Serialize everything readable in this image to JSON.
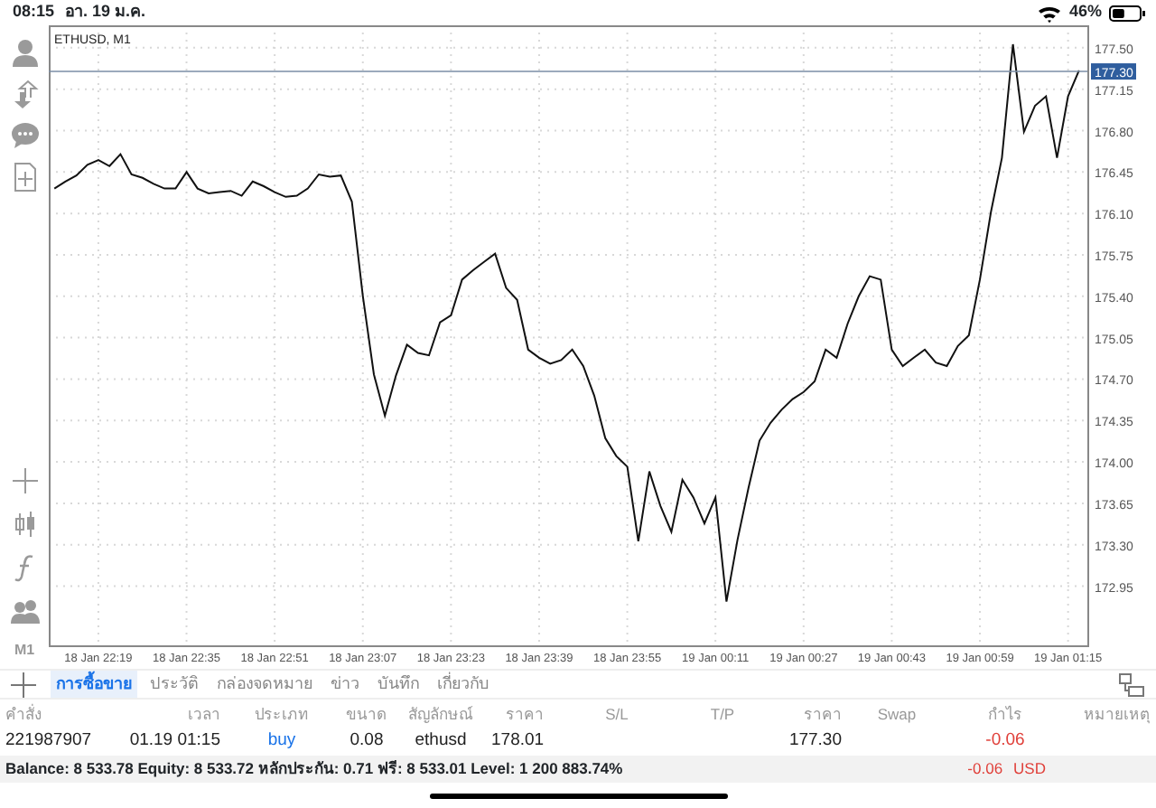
{
  "status_bar": {
    "time": "08:15",
    "date": "อา. 19 ม.ค.",
    "battery": "46%"
  },
  "left_toolbar": {
    "timeframe": "M1"
  },
  "chart": {
    "chart_data": {
      "type": "line",
      "title": "ETHUSD, M1",
      "grid": true,
      "ref_lines": [
        {
          "axis": "y",
          "value": 177.3,
          "label": "177.30"
        }
      ],
      "categories": [
        null,
        null,
        null,
        null,
        "18 Jan 22:19",
        null,
        null,
        null,
        null,
        null,
        null,
        null,
        "18 Jan 22:35",
        null,
        null,
        null,
        null,
        null,
        null,
        null,
        "18 Jan 22:51",
        null,
        null,
        null,
        null,
        null,
        null,
        null,
        "18 Jan 23:07",
        null,
        null,
        null,
        null,
        null,
        null,
        null,
        "18 Jan 23:23",
        null,
        null,
        null,
        null,
        null,
        null,
        null,
        "18 Jan 23:39",
        null,
        null,
        null,
        null,
        null,
        null,
        null,
        "18 Jan 23:55",
        null,
        null,
        null,
        null,
        null,
        null,
        null,
        "19 Jan 00:11",
        null,
        null,
        null,
        null,
        null,
        null,
        null,
        "19 Jan 00:27",
        null,
        null,
        null,
        null,
        null,
        null,
        null,
        "19 Jan 00:43",
        null,
        null,
        null,
        null,
        null,
        null,
        null,
        "19 Jan 00:59",
        null,
        null,
        null,
        null,
        null,
        null,
        null,
        "19 Jan 01:15",
        null
      ],
      "values": [
        176.31,
        176.37,
        176.42,
        176.51,
        176.55,
        176.5,
        176.6,
        176.43,
        176.4,
        176.35,
        176.31,
        176.31,
        176.45,
        176.31,
        176.27,
        176.28,
        176.29,
        176.25,
        176.37,
        176.33,
        176.28,
        176.24,
        176.25,
        176.31,
        176.43,
        176.41,
        176.42,
        176.2,
        175.4,
        174.74,
        174.39,
        174.73,
        174.99,
        174.92,
        174.9,
        175.18,
        175.24,
        175.54,
        175.62,
        175.69,
        175.76,
        175.47,
        175.37,
        174.95,
        174.88,
        174.83,
        174.86,
        174.95,
        174.81,
        174.56,
        174.2,
        174.05,
        173.96,
        173.33,
        173.92,
        173.63,
        173.41,
        173.85,
        173.7,
        173.48,
        173.7,
        172.82,
        173.34,
        173.78,
        174.18,
        174.33,
        174.44,
        174.53,
        174.59,
        174.68,
        174.95,
        174.88,
        175.17,
        175.4,
        175.57,
        175.54,
        174.95,
        174.81,
        174.88,
        174.95,
        174.84,
        174.81,
        174.98,
        175.07,
        175.54,
        176.11,
        176.57,
        177.53,
        176.79,
        177.01,
        177.09,
        176.57,
        177.09,
        177.31
      ],
      "ylim": [
        172.45,
        177.69
      ],
      "yticks": [
        {
          "value": 177.5,
          "label": "177.50"
        },
        {
          "value": 177.15,
          "label": "177.15"
        },
        {
          "value": 176.8,
          "label": "176.80"
        },
        {
          "value": 176.45,
          "label": "176.45"
        },
        {
          "value": 176.1,
          "label": "176.10"
        },
        {
          "value": 175.75,
          "label": "175.75"
        },
        {
          "value": 175.4,
          "label": "175.40"
        },
        {
          "value": 175.05,
          "label": "175.05"
        },
        {
          "value": 174.7,
          "label": "174.70"
        },
        {
          "value": 174.35,
          "label": "174.35"
        },
        {
          "value": 174.0,
          "label": "174.00"
        },
        {
          "value": 173.65,
          "label": "173.65"
        },
        {
          "value": 173.3,
          "label": "173.30"
        },
        {
          "value": 172.95,
          "label": "172.95"
        }
      ]
    }
  },
  "tabs": [
    {
      "label": "การซื้อขาย",
      "selected": true
    },
    {
      "label": "ประวัติ",
      "selected": false
    },
    {
      "label": "กล่องจดหมาย",
      "selected": false
    },
    {
      "label": "ข่าว",
      "selected": false
    },
    {
      "label": "บันทึก",
      "selected": false
    },
    {
      "label": "เกี่ยวกับ",
      "selected": false
    }
  ],
  "table": {
    "columns": [
      "คำสั่ง",
      "เวลา",
      "ประเภท",
      "ขนาด",
      "สัญลักษณ์",
      "ราคา",
      "S/L",
      "T/P",
      "ราคา",
      "Swap",
      "กำไร",
      "หมายเหตุ"
    ],
    "rows": [
      {
        "cells": [
          {
            "text": "221987907",
            "kind": "plain"
          },
          {
            "text": "01.19 01:15",
            "kind": "plain"
          },
          {
            "text": "buy",
            "kind": "link"
          },
          {
            "text": "0.08",
            "kind": "plain"
          },
          {
            "text": "ethusd",
            "kind": "plain"
          },
          {
            "text": "178.01",
            "kind": "plain"
          },
          {
            "text": ""
          },
          {
            "text": ""
          },
          {
            "text": "177.30",
            "kind": "plain"
          },
          {
            "text": ""
          },
          {
            "text": "-0.06",
            "kind": "loss"
          },
          {
            "text": ""
          }
        ]
      }
    ]
  },
  "summary": {
    "text": "Balance: 8 533.78 Equity: 8 533.72 หลักประกัน: 0.71 ฟรี: 8 533.01 Level: 1 200 883.74%",
    "total": "-0.06",
    "currency": "USD"
  }
}
